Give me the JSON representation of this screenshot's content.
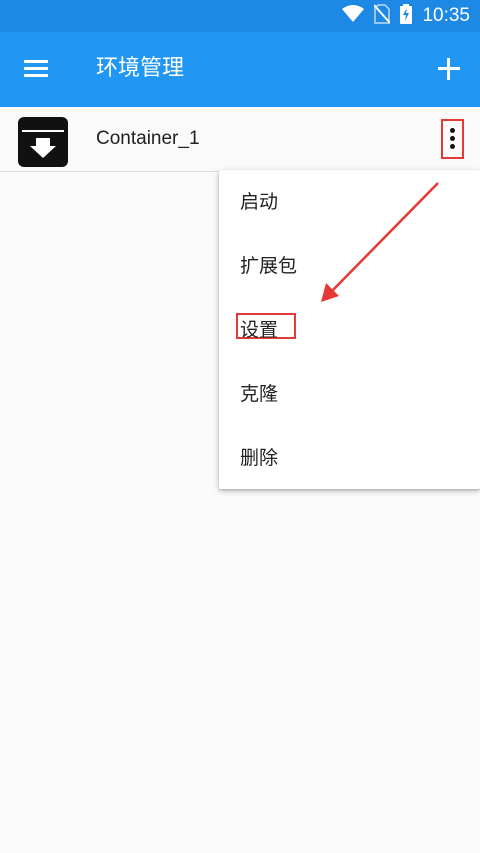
{
  "status_bar": {
    "time": "10:35",
    "icons": [
      "wifi-icon",
      "no-sim-icon",
      "battery-charging-icon"
    ]
  },
  "app_bar": {
    "title": "环境管理",
    "left_icon": "menu-icon",
    "right_icon": "add-icon"
  },
  "containers": [
    {
      "name": "Container_1",
      "icon": "archive-download-icon",
      "menu_icon": "more-vert-icon"
    }
  ],
  "popup_menu": {
    "items": [
      "启动",
      "扩展包",
      "设置",
      "克隆",
      "删除"
    ],
    "highlighted_item": "设置"
  },
  "colors": {
    "status_bar": "#1e88e5",
    "app_bar": "#2196f3",
    "background": "#fafafa",
    "annotation": "#e53935"
  }
}
